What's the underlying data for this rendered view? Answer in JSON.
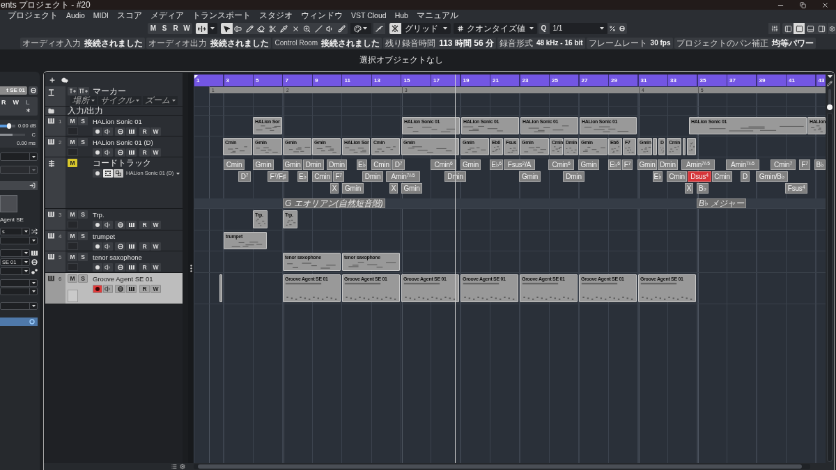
{
  "window": {
    "title": "ents プロジェクト - #20"
  },
  "menu": [
    "プロジェクト",
    "Audio",
    "MIDI",
    "スコア",
    "メディア",
    "トランスポート",
    "スタジオ",
    "ウィンドウ",
    "VST Cloud",
    "Hub",
    "マニュアル"
  ],
  "toolbar": {
    "global_buttons": [
      "M",
      "S",
      "R",
      "W"
    ],
    "autoscroll": {
      "on": true
    },
    "tools": [
      {
        "kind": "object-select",
        "selected": true
      },
      {
        "kind": "range",
        "selected": false
      },
      {
        "kind": "draw",
        "selected": false
      },
      {
        "kind": "erase",
        "selected": false
      },
      {
        "kind": "split",
        "selected": false
      },
      {
        "kind": "glue",
        "selected": false
      },
      {
        "kind": "mute",
        "selected": false
      },
      {
        "kind": "zoom",
        "selected": false
      },
      {
        "kind": "line",
        "selected": false
      },
      {
        "kind": "play",
        "selected": false
      },
      {
        "kind": "warp",
        "selected": false
      }
    ],
    "snap": {
      "on": true,
      "type": "グリッド"
    },
    "quantize": {
      "type": "クオンタイズ値",
      "button": "Q",
      "value": "1/1"
    },
    "layout_buttons": [
      {
        "on": false
      },
      {
        "on": true
      },
      {
        "on": false
      },
      {
        "on": false
      }
    ]
  },
  "status": [
    {
      "label": "オーディオ入力",
      "value": "接続されました"
    },
    {
      "label": "オーディオ出力",
      "value": "接続されました"
    },
    {
      "label": "Control Room",
      "value": "接続されました"
    },
    {
      "label": "残り録音時間",
      "value": "113 時間 56 分"
    },
    {
      "label": "録音形式",
      "value": "48 kHz - 16 bit"
    },
    {
      "label": "フレームレート",
      "value": "30 fps"
    },
    {
      "label": "プロジェクトのパン補正",
      "value": "均等パワー"
    }
  ],
  "info_line": "選択オブジェクトなし",
  "inspector": {
    "track_name": "t SE 01",
    "buttons": [
      {
        "label": "R",
        "disabled": false
      },
      {
        "label": "W",
        "disabled": false
      },
      {
        "label": "L",
        "disabled": true
      }
    ],
    "volume": {
      "level": 0.6,
      "reading": "0.00 dB"
    },
    "pan": {
      "level": 0.5,
      "reading": "C"
    },
    "delay": "0.00 ms",
    "upper_fields": [
      {
        "disabled": false
      },
      {
        "disabled": true
      }
    ],
    "instrument": "Agent SE",
    "lower_fields": [
      {
        "value": "s",
        "disabled": false
      },
      {
        "disabled": false
      },
      {
        "disabled": false
      },
      {
        "value": "SE 01",
        "disabled": false
      },
      {
        "disabled": false
      },
      {
        "disabled": false
      },
      {
        "disabled": false
      },
      {
        "disabled": false
      }
    ]
  },
  "project": {
    "ruler": [
      "1",
      "3",
      "5",
      "7",
      "9",
      "11",
      "13",
      "15",
      "17",
      "19",
      "21",
      "23",
      "25",
      "27",
      "29",
      "31",
      "33",
      "35",
      "37",
      "39",
      "41",
      "43"
    ],
    "tracks": [
      {
        "kind": "marker",
        "name": "マーカー",
        "selected": false,
        "options": [
          "場所",
          "サイクル",
          "ズーム"
        ],
        "markers": [
          "1",
          "2",
          "3",
          "4",
          "5"
        ]
      },
      {
        "kind": "folder",
        "name": "入力/出力",
        "selected": false
      },
      {
        "kind": "instrument",
        "number": "1",
        "name": "HALion Sonic 01",
        "selected": false,
        "mute": {
          "label": "M",
          "on": false
        },
        "solo": {
          "label": "S",
          "on": false
        },
        "record_enabled": false,
        "automation": [
          "R",
          "W"
        ],
        "events": [
          {
            "name": "HALion Sor",
            "selected": false
          },
          {
            "name": "HALion Sonic 01",
            "selected": false
          },
          {
            "name": "HALion Sonic 01",
            "selected": false
          },
          {
            "name": "HALion Sonic 01",
            "selected": false
          },
          {
            "name": "HALion Sonic 01",
            "selected": false
          },
          {
            "name": "HALion Sonic 01",
            "selected": false
          },
          {
            "name": "HALion",
            "selected": false
          }
        ]
      },
      {
        "kind": "instrument",
        "number": "2",
        "name": "HALion Sonic 01 (D)",
        "selected": false,
        "mute": {
          "label": "M",
          "on": false
        },
        "solo": {
          "label": "S",
          "on": false
        },
        "record_enabled": false,
        "automation": [
          "R",
          "W"
        ],
        "events": [
          {
            "name": "Cmin",
            "selected": false
          },
          {
            "name": "Gmin",
            "selected": false
          },
          {
            "name": "Gmin",
            "selected": false
          },
          {
            "name": "Gmin",
            "selected": false
          },
          {
            "name": "HALion Sor",
            "selected": false
          },
          {
            "name": "Cmin",
            "selected": false
          },
          {
            "name": "Gmin",
            "selected": false
          },
          {
            "name": "Gmin",
            "selected": false
          },
          {
            "name": "Eb6",
            "selected": false
          },
          {
            "name": "Fsus",
            "selected": false
          },
          {
            "name": "Gmin",
            "selected": false
          },
          {
            "name": "Cmin",
            "selected": false
          },
          {
            "name": "Dmin",
            "selected": false
          },
          {
            "name": "Gmin",
            "selected": false
          },
          {
            "name": "Eb6",
            "selected": false
          },
          {
            "name": "F7",
            "selected": false
          },
          {
            "name": "Gmin",
            "selected": false
          },
          {
            "selected": false
          },
          {
            "name": "D",
            "selected": false
          },
          {
            "name": "Cmin",
            "selected": false
          },
          {
            "selected": false
          },
          {
            "selected": false
          }
        ]
      },
      {
        "kind": "chord",
        "name": "コードトラック",
        "selected": false,
        "mute": {
          "label": "M",
          "on": true
        },
        "output": "HALion Sonic 01 (D)",
        "chords": [
          {
            "name": "Cmin",
            "selected": false
          },
          {
            "name": "Gmin",
            "selected": false
          },
          {
            "name": "Gmin",
            "selected": false
          },
          {
            "name": "Dmin",
            "selected": false
          },
          {
            "name": "Dmin",
            "selected": false
          },
          {
            "name": "E♭",
            "selected": false
          },
          {
            "name": "Cmin",
            "selected": false
          },
          {
            "name": "D$^{7}$",
            "selected": false
          },
          {
            "name": "Cmin$^{6}$",
            "selected": false
          },
          {
            "name": "Gmin",
            "selected": false
          },
          {
            "name": "E♭$^{6}$",
            "selected": false
          },
          {
            "name": "Fsus$^{2}$/A",
            "selected": false
          },
          {
            "name": "Cmin$^{6}$",
            "selected": false
          },
          {
            "name": "Gmin",
            "selected": false
          },
          {
            "name": "E♭$^{6}$",
            "selected": false
          },
          {
            "name": "F$^{7}$",
            "selected": false
          },
          {
            "name": "Gmin",
            "selected": false
          },
          {
            "name": "Dmin",
            "selected": false
          },
          {
            "name": "Amin$^{7/♭5}$",
            "selected": false
          },
          {
            "name": "Amin$^{7/♭5}$",
            "selected": false
          },
          {
            "name": "Cmin$^{7}$",
            "selected": false
          },
          {
            "name": "F$^{7}$",
            "selected": false
          },
          {
            "name": "B♭",
            "selected": false
          },
          {
            "name": "D$^{7}$",
            "selected": false
          },
          {
            "name": "F$^{7}$/F♯",
            "selected": false
          },
          {
            "name": "E♭",
            "selected": false
          },
          {
            "name": "Cmin",
            "selected": false
          },
          {
            "name": "F$^{7}$",
            "selected": false
          },
          {
            "name": "Dmin",
            "selected": false
          },
          {
            "name": "Amin$^{7/♭5}$",
            "selected": false
          },
          {
            "name": "Dmin",
            "selected": false
          },
          {
            "name": "Gmin",
            "selected": false
          },
          {
            "name": "Dmin",
            "selected": false
          },
          {
            "name": "E♭",
            "selected": false
          },
          {
            "name": "Cmin",
            "selected": false
          },
          {
            "name": "Dsus$^{4}$",
            "selected": true
          },
          {
            "name": "Cmin",
            "selected": false
          },
          {
            "name": "D",
            "selected": false
          },
          {
            "name": "Gmin/B♭",
            "selected": false
          },
          {
            "name": "X",
            "selected": false
          },
          {
            "name": "Gmin",
            "selected": false
          },
          {
            "name": "X",
            "selected": false
          },
          {
            "name": "Gmin",
            "selected": false
          },
          {
            "name": "X",
            "selected": false
          },
          {
            "name": "B♭",
            "selected": false
          },
          {
            "name": "Fsus$^{4}$",
            "selected": false
          }
        ],
        "scales": [
          {
            "name": "G エオリアン(自然短音階)"
          },
          {
            "name": "B♭ メジャー"
          }
        ]
      },
      {
        "kind": "instrument",
        "number": "3",
        "name": "Trp.",
        "selected": false,
        "mute": {
          "label": "M",
          "on": false
        },
        "solo": {
          "label": "S",
          "on": false
        },
        "record_enabled": false,
        "automation": [
          "R",
          "W"
        ],
        "events": [
          {
            "name": "Trp.",
            "selected": false
          },
          {
            "name": "Trp.",
            "selected": false
          }
        ]
      },
      {
        "kind": "instrument",
        "number": "4",
        "name": "trumpet",
        "selected": false,
        "mute": {
          "label": "M",
          "on": false
        },
        "solo": {
          "label": "S",
          "on": false
        },
        "record_enabled": false,
        "automation": [
          "R",
          "W"
        ],
        "events": [
          {
            "name": "trumpet",
            "selected": false
          }
        ]
      },
      {
        "kind": "instrument",
        "number": "5",
        "name": "tenor saxophone",
        "selected": false,
        "mute": {
          "label": "M",
          "on": false
        },
        "solo": {
          "label": "S",
          "on": false
        },
        "record_enabled": false,
        "automation": [
          "R",
          "W"
        ],
        "events": [
          {
            "name": "tenor saxophone",
            "selected": false
          },
          {
            "name": "tenor saxophone",
            "selected": false
          }
        ]
      },
      {
        "kind": "instrument",
        "number": "6",
        "name": "Groove Agent SE 01",
        "selected": true,
        "mute": {
          "label": "M",
          "on": false
        },
        "solo": {
          "label": "S",
          "on": false
        },
        "record_enabled": true,
        "automation": [
          "R",
          "W"
        ],
        "events": [
          {
            "selected": false
          },
          {
            "name": "Groove Agent SE 01",
            "selected": false
          },
          {
            "name": "Groove Agent SE 01",
            "selected": false
          },
          {
            "name": "Groove Agent SE 01",
            "selected": false
          },
          {
            "name": "Groove Agent SE 01",
            "selected": false
          },
          {
            "name": "Groove Agent SE 01",
            "selected": false
          },
          {
            "name": "Groove Agent SE 01",
            "selected": false
          },
          {
            "name": "Groove Agent SE 01",
            "selected": false
          }
        ]
      }
    ],
    "vertical_zoom": {
      "level": 0.05
    }
  }
}
